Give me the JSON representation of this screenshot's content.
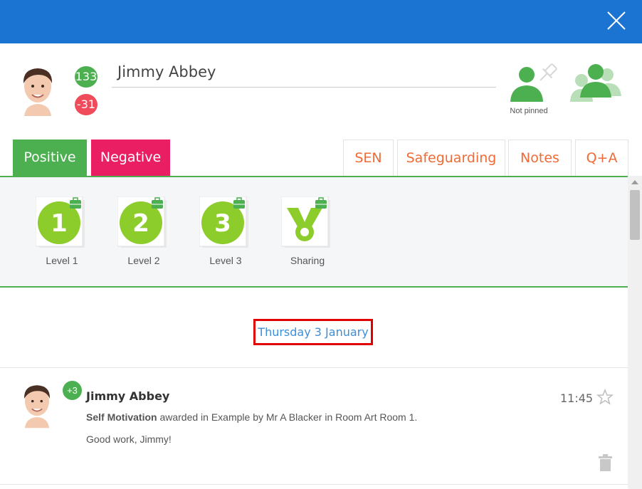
{
  "student": {
    "name": "Jimmy Abbey",
    "points_positive": "133",
    "points_negative": "-31"
  },
  "pin": {
    "label": "Not pinned"
  },
  "tabs": {
    "positive": "Positive",
    "negative": "Negative",
    "sen": "SEN",
    "safeguarding": "Safeguarding",
    "notes": "Notes",
    "qa": "Q+A"
  },
  "behaviours": [
    {
      "number": "1",
      "label": "Level 1"
    },
    {
      "number": "2",
      "label": "Level 2"
    },
    {
      "number": "3",
      "label": "Level 3"
    },
    {
      "number": "",
      "label": "Sharing"
    }
  ],
  "feed": {
    "date": "Thursday 3 January",
    "entry": {
      "points": "+3",
      "name": "Jimmy Abbey",
      "behaviour": "Self Motivation",
      "detail": "awarded in Example by Mr A Blacker in Room Art Room 1.",
      "comment": "Good work, Jimmy!",
      "time": "11:45"
    }
  },
  "colors": {
    "topbar": "#1b74d1",
    "positive": "#4caf50",
    "negative": "#e91e63",
    "tab_text": "#f06a35",
    "date_link": "#3b8fdb",
    "highlight_box": "#e00000",
    "badge_green": "#8ccc2b"
  },
  "icons": {
    "close": "close-icon",
    "pin": "pin-icon",
    "group": "group-icon",
    "star": "star-icon",
    "trash": "trash-icon",
    "medal": "medal-icon"
  }
}
